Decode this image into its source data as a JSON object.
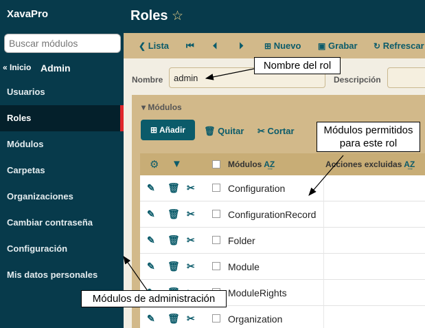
{
  "sidebar": {
    "brand": "XavaPro",
    "search_placeholder": "Buscar módulos",
    "breadcrumb_home": "« Inicio",
    "breadcrumb_current": "Admin",
    "items": [
      {
        "label": "Usuarios"
      },
      {
        "label": "Roles",
        "active": true
      },
      {
        "label": "Módulos"
      },
      {
        "label": "Carpetas"
      },
      {
        "label": "Organizaciones"
      },
      {
        "label": "Cambiar contraseña"
      },
      {
        "label": "Configuración"
      },
      {
        "label": "Mis datos personales"
      }
    ]
  },
  "header": {
    "title": "Roles",
    "star_icon": "star-outline-icon"
  },
  "toolbar": {
    "list_label": "Lista",
    "new_label": "Nuevo",
    "save_label": "Grabar",
    "refresh_label": "Refrescar"
  },
  "form": {
    "name_label": "Nombre",
    "name_value": "admin",
    "description_label": "Descripción",
    "description_value": ""
  },
  "modules_panel": {
    "title": "Módulos",
    "add_label": "Añadir",
    "remove_label": "Quitar",
    "cut_label": "Cortar",
    "columns": {
      "modules": "Módulos",
      "excluded_actions": "Acciones excluidas"
    },
    "rows": [
      {
        "name": "Configuration"
      },
      {
        "name": "ConfigurationRecord"
      },
      {
        "name": "Folder"
      },
      {
        "name": "Module"
      },
      {
        "name": "ModuleRights"
      },
      {
        "name": "Organization"
      }
    ]
  },
  "callouts": {
    "role_name": "Nombre del rol",
    "allowed_modules": "Módulos permitidos para este rol",
    "admin_modules": "Módulos de administración"
  },
  "colors": {
    "sidebar_bg": "#073a4b",
    "accent": "#0b5b6a",
    "active_marker": "#e0262b",
    "toolbar_bg": "#d2b98a"
  }
}
